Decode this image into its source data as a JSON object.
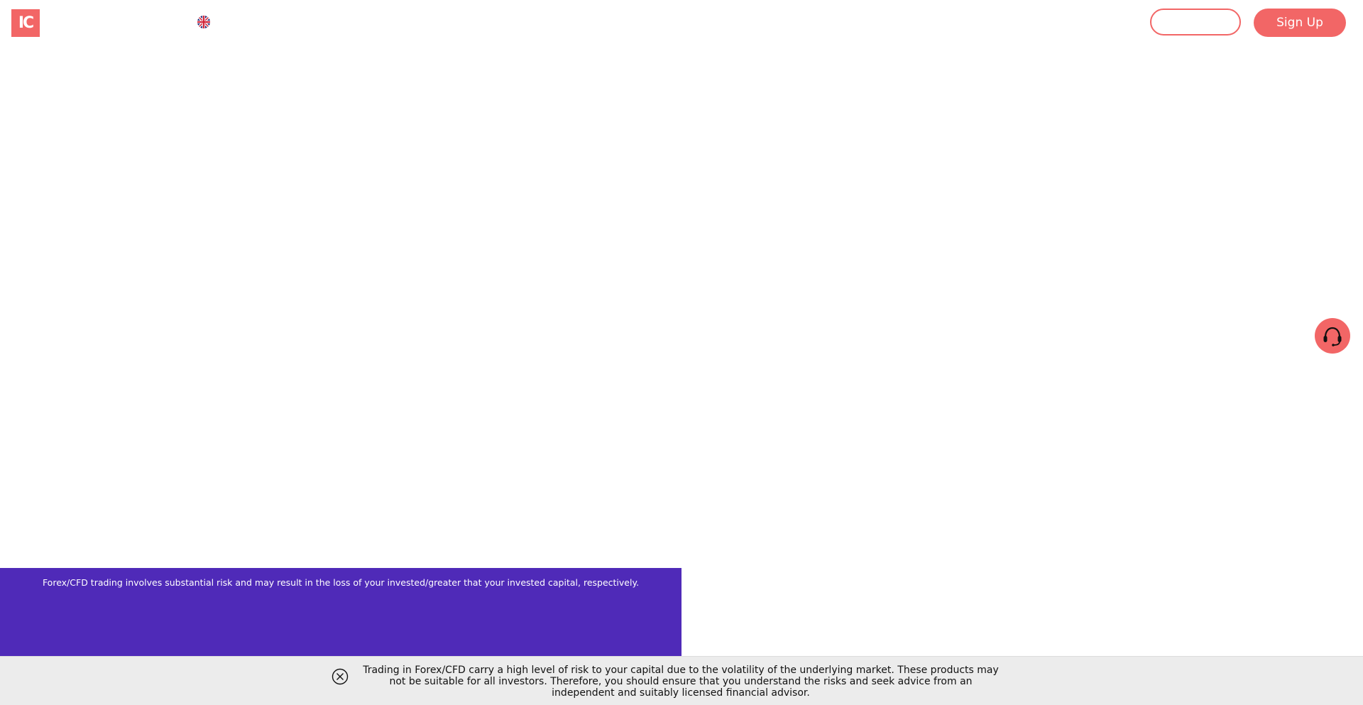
{
  "header": {
    "logo_text": "IC",
    "login_label": "",
    "signup_label": "Sign Up"
  },
  "icons": {
    "language": "uk-flag-icon",
    "support": "headset-icon",
    "close": "close-circle-icon"
  },
  "colors": {
    "brand": "#f26666",
    "banner": "#4f2ab8",
    "disclaimer_bg": "#ececec"
  },
  "risk_banner": {
    "text": "Forex/CFD trading involves substantial risk and may result in the loss of your invested/greater that your invested capital, respectively."
  },
  "disclaimer": {
    "text": "Trading in Forex/CFD carry a high level of risk to your capital due to the volatility of the underlying market. These products may not be suitable for all investors. Therefore, you should ensure that you understand the risks and seek advice from an independent and suitably licensed financial advisor."
  }
}
